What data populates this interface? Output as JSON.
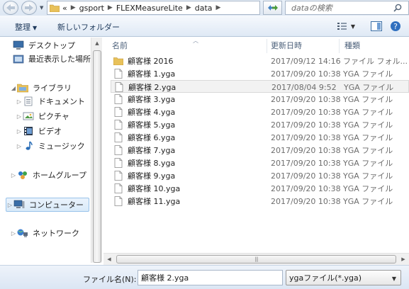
{
  "address": {
    "overflow": "«",
    "crumbs": [
      "gsport",
      "FLEXMeasureLite",
      "data"
    ]
  },
  "search": {
    "placeholder": "dataの検索"
  },
  "toolbar": {
    "organize_label": "整理",
    "new_folder_label": "新しいフォルダー"
  },
  "navigation": {
    "items": [
      {
        "label": "デスクトップ",
        "icon": "desktop-icon"
      },
      {
        "label": "最近表示した場所",
        "icon": "recent-places-icon"
      },
      {
        "label": "ライブラリ",
        "icon": "libraries-icon"
      },
      {
        "label": "ドキュメント",
        "icon": "documents-icon"
      },
      {
        "label": "ピクチャ",
        "icon": "pictures-icon"
      },
      {
        "label": "ビデオ",
        "icon": "videos-icon"
      },
      {
        "label": "ミュージック",
        "icon": "music-icon"
      },
      {
        "label": "ホームグループ",
        "icon": "homegroup-icon"
      },
      {
        "label": "コンピューター",
        "icon": "computer-icon",
        "selected": true
      },
      {
        "label": "ネットワーク",
        "icon": "network-icon"
      }
    ]
  },
  "filelist": {
    "columns": {
      "name": "名前",
      "date": "更新日時",
      "type": "種類"
    },
    "rows": [
      {
        "name": "顧客様 2016",
        "date": "2017/09/12 14:16",
        "type": "ファイル フォル...",
        "icon": "folder-icon"
      },
      {
        "name": "顧客様 1.yga",
        "date": "2017/09/20 10:38",
        "type": "YGA ファイル",
        "icon": "file-icon"
      },
      {
        "name": "顧客様 2.yga",
        "date": "2017/08/04 9:52",
        "type": "YGA ファイル",
        "icon": "file-icon",
        "selected": true
      },
      {
        "name": "顧客様 3.yga",
        "date": "2017/09/20 10:38",
        "type": "YGA ファイル",
        "icon": "file-icon"
      },
      {
        "name": "顧客様 4.yga",
        "date": "2017/09/20 10:38",
        "type": "YGA ファイル",
        "icon": "file-icon"
      },
      {
        "name": "顧客様 5.yga",
        "date": "2017/09/20 10:38",
        "type": "YGA ファイル",
        "icon": "file-icon"
      },
      {
        "name": "顧客様 6.yga",
        "date": "2017/09/20 10:38",
        "type": "YGA ファイル",
        "icon": "file-icon"
      },
      {
        "name": "顧客様 7.yga",
        "date": "2017/09/20 10:38",
        "type": "YGA ファイル",
        "icon": "file-icon"
      },
      {
        "name": "顧客様 8.yga",
        "date": "2017/09/20 10:38",
        "type": "YGA ファイル",
        "icon": "file-icon"
      },
      {
        "name": "顧客様 9.yga",
        "date": "2017/09/20 10:38",
        "type": "YGA ファイル",
        "icon": "file-icon"
      },
      {
        "name": "顧客様 10.yga",
        "date": "2017/09/20 10:38",
        "type": "YGA ファイル",
        "icon": "file-icon"
      },
      {
        "name": "顧客様 11.yga",
        "date": "2017/09/20 10:38",
        "type": "YGA ファイル",
        "icon": "file-icon"
      }
    ]
  },
  "bottom": {
    "filename_label": "ファイル名(N):",
    "filename_value": "顧客様 2.yga",
    "filetype_value": "ygaファイル(*.yga)"
  },
  "colors": {
    "toolbar_text": "#1e395b",
    "selection_border": "#99c3ea",
    "folder_yellow": "#e8c15a"
  }
}
